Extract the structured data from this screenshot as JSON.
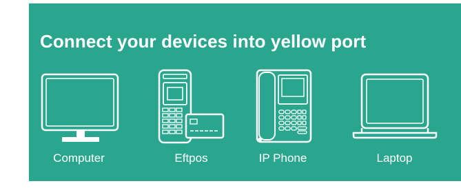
{
  "header": {
    "title": "Connect your devices into yellow port"
  },
  "devices": [
    {
      "label": "Computer",
      "icon": "computer-icon"
    },
    {
      "label": "Eftpos",
      "icon": "eftpos-icon"
    },
    {
      "label": "IP Phone",
      "icon": "ip-phone-icon"
    },
    {
      "label": "Laptop",
      "icon": "laptop-icon"
    }
  ],
  "colors": {
    "background": "#2aa68e",
    "line": "#ffffff",
    "fill": "#2aa68e",
    "screen": "#2aa68e"
  }
}
